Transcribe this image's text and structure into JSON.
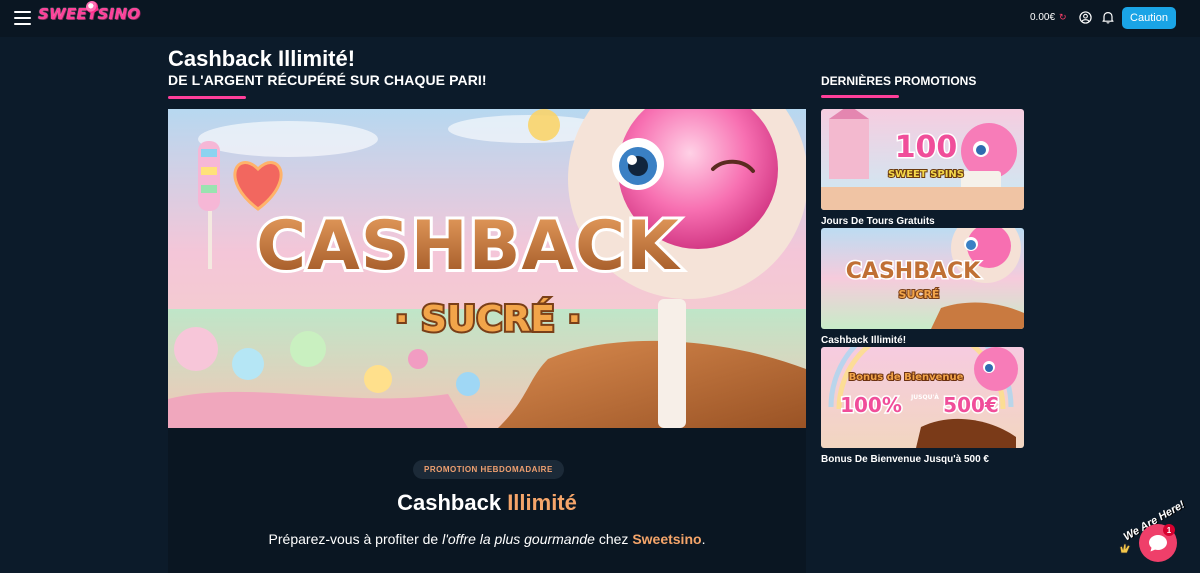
{
  "header": {
    "logo": "SWEETSINO",
    "balance": "0.00€",
    "caution_label": "Caution"
  },
  "main": {
    "title": "Cashback Illimité!",
    "subtitle": "DE L'ARGENT RÉCUPÉRÉ SUR CHAQUE PARI!",
    "hero_line1": "CASHBACK",
    "hero_line2": "· SUCRÉ ·",
    "promo": {
      "badge": "PROMOTION HEBDOMADAIRE",
      "title_part1": "Cashback ",
      "title_part2": "Illimité",
      "desc_part1": "Préparez-vous à profiter de ",
      "desc_italic": "l'offre la plus gourmande",
      "desc_part2": " chez ",
      "desc_brand": "Sweetsino",
      "desc_end": "."
    }
  },
  "sidebar": {
    "title": "DERNIÈRES PROMOTIONS",
    "promotions": [
      {
        "label": "Jours De Tours Gratuits",
        "img_line1": "100",
        "img_line2": "SWEET SPINS"
      },
      {
        "label": "Cashback Illimité!",
        "img_line1": "CASHBACK",
        "img_line2": "SUCRÉ"
      },
      {
        "label": "Bonus De Bienvenue Jusqu'à 500 €",
        "img_line1": "Bonus de Bienvenue",
        "img_line2": "100%",
        "img_line3": "JUSQU'À",
        "img_line4": "500€"
      }
    ]
  },
  "chat": {
    "text": "We Are Here!",
    "badge": "1"
  },
  "colors": {
    "background": "#0c1b2a",
    "topbar": "#0a1622",
    "accent_pink": "#ff3f9a",
    "accent_orange": "#f5a56a",
    "caution_blue": "#1aa4e6",
    "chat_red": "#ef3f6a"
  }
}
